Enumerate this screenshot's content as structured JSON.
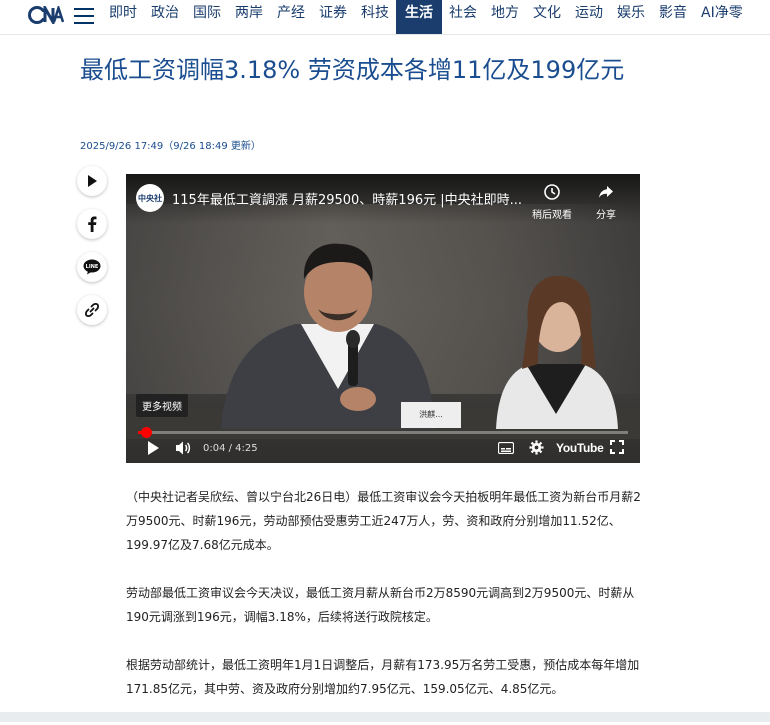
{
  "nav": {
    "logo_text": "CNA",
    "items": [
      "即时",
      "政治",
      "国际",
      "两岸",
      "产经",
      "证券",
      "科技",
      "生活",
      "社会",
      "地方",
      "文化",
      "运动",
      "娱乐",
      "影音",
      "AI净零"
    ],
    "active": "生活"
  },
  "article": {
    "title": "最低工资调幅3.18% 劳资成本各增11亿及199亿元",
    "dateline": "2025/9/26 17:49（9/26 18:49 更新）",
    "paragraphs": [
      "（中央社记者吴欣纭、曾以宁台北26日电）最低工资审议会今天拍板明年最低工资为新台币月薪2万9500元、时薪196元，劳动部预估受惠劳工近247万人，劳、资和政府分别增加11.52亿、199.97亿及7.68亿元成本。",
      "劳动部最低工资审议会今天决议，最低工资月薪从新台币2万8590元调高到2万9500元、时薪从190元调涨到196元，调幅3.18%，后续将送行政院核定。",
      "根据劳动部统计，最低工资明年1月1日调整后，月薪有173.95万名劳工受惠，预估成本每年增加171.85亿元，其中劳、资及政府分别增加约7.95亿元、159.05亿元、4.85亿元。"
    ]
  },
  "share": {
    "icons": [
      "play-icon",
      "facebook-icon",
      "line-icon",
      "link-icon"
    ],
    "line_label": "LINE"
  },
  "video": {
    "channel_logo": "中央社",
    "title": "115年最低工資調漲 月薪29500、時薪196元 |中央社即時...",
    "watch_later": "稍后观看",
    "share": "分享",
    "more_videos": "更多视频",
    "time": "0:04 / 4:25",
    "progress": 0.016,
    "brand": "YouTube",
    "nameplate": "洪麒...(部分可见)"
  },
  "colors": {
    "brand": "#1a3d6e",
    "headline": "#1a4d8f",
    "progress": "#ff0000"
  }
}
